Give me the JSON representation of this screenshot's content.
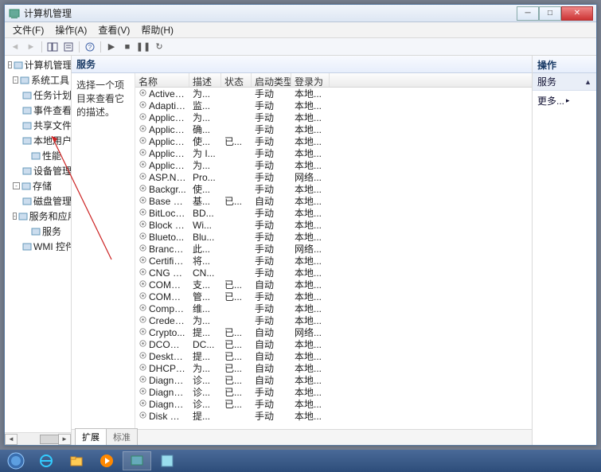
{
  "window": {
    "title": "计算机管理"
  },
  "menu": {
    "file": "文件(F)",
    "action": "操作(A)",
    "view": "查看(V)",
    "help": "帮助(H)"
  },
  "tree": [
    {
      "level": 0,
      "exp": "-",
      "label": "计算机管理(本"
    },
    {
      "level": 1,
      "exp": "-",
      "label": "系统工具"
    },
    {
      "level": 2,
      "exp": "",
      "label": "任务计划程"
    },
    {
      "level": 2,
      "exp": "",
      "label": "事件查看器"
    },
    {
      "level": 2,
      "exp": "",
      "label": "共享文件夹"
    },
    {
      "level": 2,
      "exp": "",
      "label": "本地用户和"
    },
    {
      "level": 2,
      "exp": "",
      "label": "性能"
    },
    {
      "level": 2,
      "exp": "",
      "label": "设备管理器"
    },
    {
      "level": 1,
      "exp": "-",
      "label": "存储"
    },
    {
      "level": 2,
      "exp": "",
      "label": "磁盘管理"
    },
    {
      "level": 1,
      "exp": "-",
      "label": "服务和应用程"
    },
    {
      "level": 2,
      "exp": "",
      "label": "服务"
    },
    {
      "level": 2,
      "exp": "",
      "label": "WMI 控件"
    }
  ],
  "center": {
    "header": "服务",
    "desc": "选择一个项目来查看它的描述。",
    "columns": {
      "name": "名称",
      "desc": "描述",
      "status": "状态",
      "startup": "启动类型",
      "logon": "登录为"
    },
    "services": [
      {
        "name": "ActiveX...",
        "desc": "为...",
        "status": "",
        "startup": "手动",
        "logon": "本地..."
      },
      {
        "name": "Adaptiv...",
        "desc": "监...",
        "status": "",
        "startup": "手动",
        "logon": "本地..."
      },
      {
        "name": "Applica...",
        "desc": "为...",
        "status": "",
        "startup": "手动",
        "logon": "本地..."
      },
      {
        "name": "Applica...",
        "desc": "确...",
        "status": "",
        "startup": "手动",
        "logon": "本地..."
      },
      {
        "name": "Applica...",
        "desc": "使...",
        "status": "已...",
        "startup": "手动",
        "logon": "本地..."
      },
      {
        "name": "Applica...",
        "desc": "为 I...",
        "status": "",
        "startup": "手动",
        "logon": "本地..."
      },
      {
        "name": "Applica...",
        "desc": "为...",
        "status": "",
        "startup": "手动",
        "logon": "本地..."
      },
      {
        "name": "ASP.NE...",
        "desc": "Pro...",
        "status": "",
        "startup": "手动",
        "logon": "网络..."
      },
      {
        "name": "Backgr...",
        "desc": "使...",
        "status": "",
        "startup": "手动",
        "logon": "本地..."
      },
      {
        "name": "Base Fil...",
        "desc": "基...",
        "status": "已...",
        "startup": "自动",
        "logon": "本地..."
      },
      {
        "name": "BitLock...",
        "desc": "BD...",
        "status": "",
        "startup": "手动",
        "logon": "本地..."
      },
      {
        "name": "Block L...",
        "desc": "Wi...",
        "status": "",
        "startup": "手动",
        "logon": "本地..."
      },
      {
        "name": "Blueto...",
        "desc": "Blu...",
        "status": "",
        "startup": "手动",
        "logon": "本地..."
      },
      {
        "name": "Branch...",
        "desc": "此...",
        "status": "",
        "startup": "手动",
        "logon": "网络..."
      },
      {
        "name": "Certific...",
        "desc": "将...",
        "status": "",
        "startup": "手动",
        "logon": "本地..."
      },
      {
        "name": "CNG K...",
        "desc": "CN...",
        "status": "",
        "startup": "手动",
        "logon": "本地..."
      },
      {
        "name": "COM+ ...",
        "desc": "支...",
        "status": "已...",
        "startup": "自动",
        "logon": "本地..."
      },
      {
        "name": "COM+ ...",
        "desc": "管...",
        "status": "已...",
        "startup": "手动",
        "logon": "本地..."
      },
      {
        "name": "Compu...",
        "desc": "维...",
        "status": "",
        "startup": "手动",
        "logon": "本地..."
      },
      {
        "name": "Creden...",
        "desc": "为...",
        "status": "",
        "startup": "手动",
        "logon": "本地..."
      },
      {
        "name": "Crypto...",
        "desc": "提...",
        "status": "已...",
        "startup": "自动",
        "logon": "网络..."
      },
      {
        "name": "DCOM ...",
        "desc": "DC...",
        "status": "已...",
        "startup": "自动",
        "logon": "本地..."
      },
      {
        "name": "Deskto...",
        "desc": "提...",
        "status": "已...",
        "startup": "自动",
        "logon": "本地..."
      },
      {
        "name": "DHCP ...",
        "desc": "为...",
        "status": "已...",
        "startup": "自动",
        "logon": "本地..."
      },
      {
        "name": "Diagno...",
        "desc": "诊...",
        "status": "已...",
        "startup": "自动",
        "logon": "本地..."
      },
      {
        "name": "Diagno...",
        "desc": "诊...",
        "status": "已...",
        "startup": "手动",
        "logon": "本地..."
      },
      {
        "name": "Diagno...",
        "desc": "诊...",
        "status": "已...",
        "startup": "手动",
        "logon": "本地..."
      },
      {
        "name": "Disk De...",
        "desc": "提...",
        "status": "",
        "startup": "手动",
        "logon": "本地..."
      }
    ],
    "tabs": {
      "extended": "扩展",
      "standard": "标准"
    }
  },
  "actions": {
    "header": "操作",
    "sub": "服务",
    "more": "更多..."
  }
}
